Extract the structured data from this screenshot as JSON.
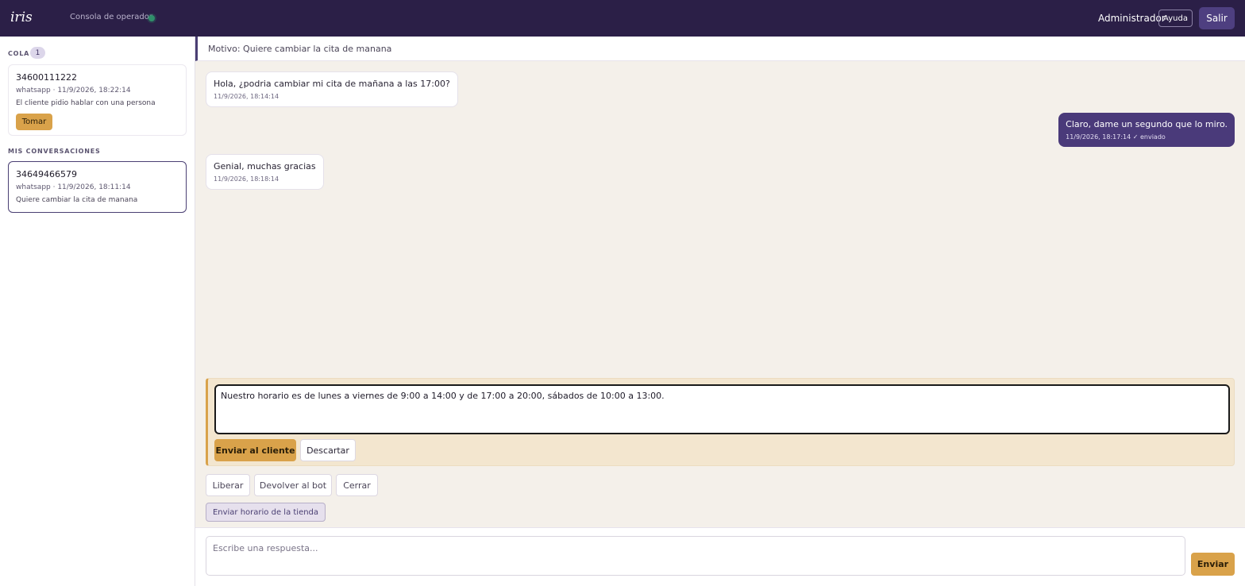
{
  "header": {
    "logo": "iris",
    "console_label": "Consola de operador",
    "user_name": "Administrador",
    "help_label": "Ayuda",
    "logout_label": "Salir",
    "status_color": "#2f8f6a"
  },
  "sidebar": {
    "queue_title": "COLA",
    "queue_count": "1",
    "queue": [
      {
        "phone": "34600111222",
        "meta": "whatsapp · 11/9/2026, 18:22:14",
        "reason": "El cliente pidio hablar con una persona",
        "take_label": "Tomar"
      }
    ],
    "mine_title": "MIS CONVERSACIONES",
    "mine": [
      {
        "phone": "34649466579",
        "meta": "whatsapp · 11/9/2026, 18:11:14",
        "reason": "Quiere cambiar la cita de manana"
      }
    ]
  },
  "conversation": {
    "reason": "Motivo: Quiere cambiar la cita de manana",
    "messages": [
      {
        "direction": "in",
        "text": "Hola, ¿podria cambiar mi cita de mañana a las 17:00?",
        "time": "11/9/2026, 18:14:14"
      },
      {
        "direction": "out",
        "text": "Claro, dame un segundo que lo miro.",
        "time": "11/9/2026, 18:17:14 ✓ enviado"
      },
      {
        "direction": "in",
        "text": "Genial, muchas gracias",
        "time": "11/9/2026, 18:18:14"
      }
    ]
  },
  "draft": {
    "text": "Nuestro horario es de lunes a viernes de 9:00 a 14:00 y de 17:00 a 20:00, sábados de 10:00 a 13:00.",
    "send_label": "Enviar al cliente",
    "discard_label": "Descartar"
  },
  "actions": {
    "release_label": "Liberar",
    "return_bot_label": "Devolver al bot",
    "close_label": "Cerrar",
    "hours_label": "Enviar horario de la tienda"
  },
  "composer": {
    "placeholder": "Escribe una respuesta...",
    "send_label": "Enviar"
  },
  "colors": {
    "header_bg": "#2b1f47",
    "accent": "#d9a24a",
    "outgoing_bubble": "#4a3a7a"
  }
}
